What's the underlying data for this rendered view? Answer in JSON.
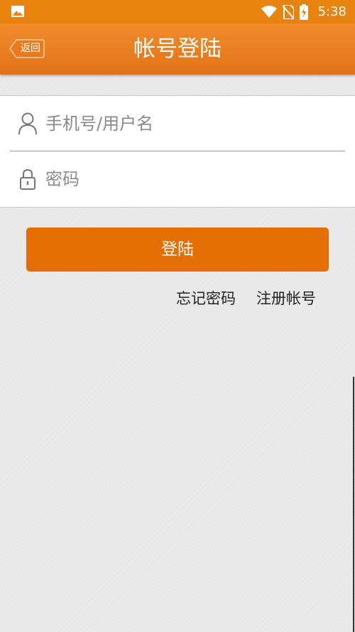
{
  "status_bar": {
    "time": "5:38",
    "icons": [
      "image-icon",
      "wifi-icon",
      "no-sim-icon",
      "battery-charging-icon"
    ]
  },
  "app_bar": {
    "back_label": "返回",
    "title": "帐号登陆"
  },
  "form": {
    "username_placeholder": "手机号/用户名",
    "username_value": "",
    "password_placeholder": "密码",
    "password_value": ""
  },
  "actions": {
    "login_label": "登陆",
    "forgot_password_label": "忘记密码",
    "register_label": "注册帐号"
  },
  "colors": {
    "brand_orange": "#e36f04",
    "app_bar_orange": "#e8830f"
  }
}
